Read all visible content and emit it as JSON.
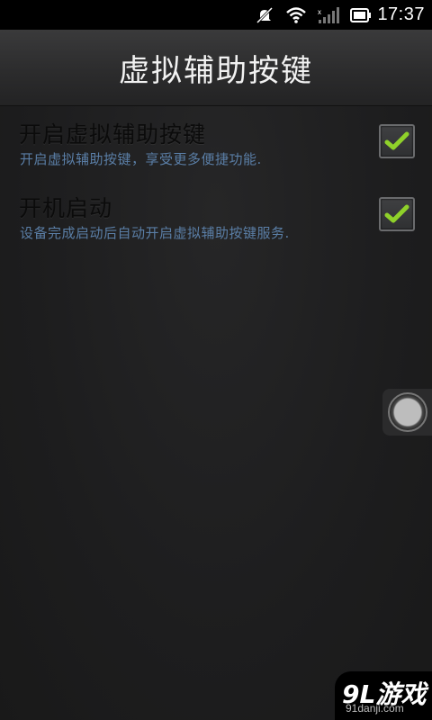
{
  "status_bar": {
    "icons": [
      "no-notification-icon",
      "wifi-icon",
      "signal-icon",
      "battery-icon"
    ],
    "time": "17:37"
  },
  "header": {
    "title": "虚拟辅助按键"
  },
  "settings": [
    {
      "title": "开启虚拟辅助按键",
      "summary": "开启虚拟辅助按键，享受更多便捷功能.",
      "checked": true
    },
    {
      "title": "开机启动",
      "summary": "设备完成启动后自动开启虚拟辅助按键服务.",
      "checked": true
    }
  ],
  "floating_button": {
    "icon": "assistive-touch-icon"
  },
  "watermark": {
    "logo": "9L游戏",
    "url": "91danji.com"
  },
  "colors": {
    "background": "#1c1c1d",
    "summary_text": "#5a7ea6",
    "check_mark": "#8fd12a"
  }
}
